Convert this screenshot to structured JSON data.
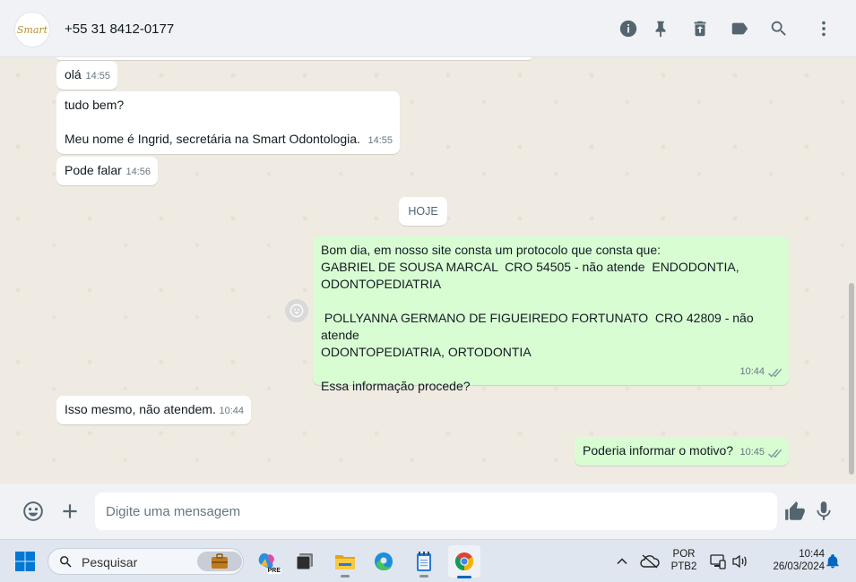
{
  "header": {
    "avatar_text": "Smart",
    "contact_name": "+55 31 8412-0177",
    "icons": [
      "info-icon",
      "pin-icon",
      "trash-icon",
      "label-icon",
      "search-icon",
      "more-vertical-icon"
    ]
  },
  "messages": [
    {
      "direction": "in",
      "text": "olá",
      "time": "14:55"
    },
    {
      "direction": "in",
      "text": "tudo bem?\n\nMeu nome é Ingrid, secretária na Smart Odontologia.",
      "time": "14:55"
    },
    {
      "direction": "in",
      "text": "Pode falar",
      "time": "14:56"
    },
    {
      "direction": "out",
      "text": "Bom dia, em nosso site consta um protocolo que consta que:\nGABRIEL DE SOUSA MARCAL  CRO 54505 - não atende  ENDODONTIA,\nODONTOPEDIATRIA\n\n POLLYANNA GERMANO DE FIGUEIREDO FORTUNATO  CRO 42809 - não atende\nODONTOPEDIATRIA, ORTODONTIA\n\nEssa informação procede?",
      "time": "10:44"
    },
    {
      "direction": "in",
      "text": "Isso mesmo, não atendem.",
      "time": "10:44"
    },
    {
      "direction": "out",
      "text": "Poderia informar o motivo?",
      "time": "10:45"
    }
  ],
  "date_separator": "HOJE",
  "composer": {
    "placeholder": "Digite uma mensagem"
  },
  "taskbar": {
    "search_placeholder": "Pesquisar",
    "copilot_badge": "PRE",
    "language_line1": "POR",
    "language_line2": "PTB2",
    "clock_time": "10:44",
    "clock_date": "26/03/2024"
  }
}
